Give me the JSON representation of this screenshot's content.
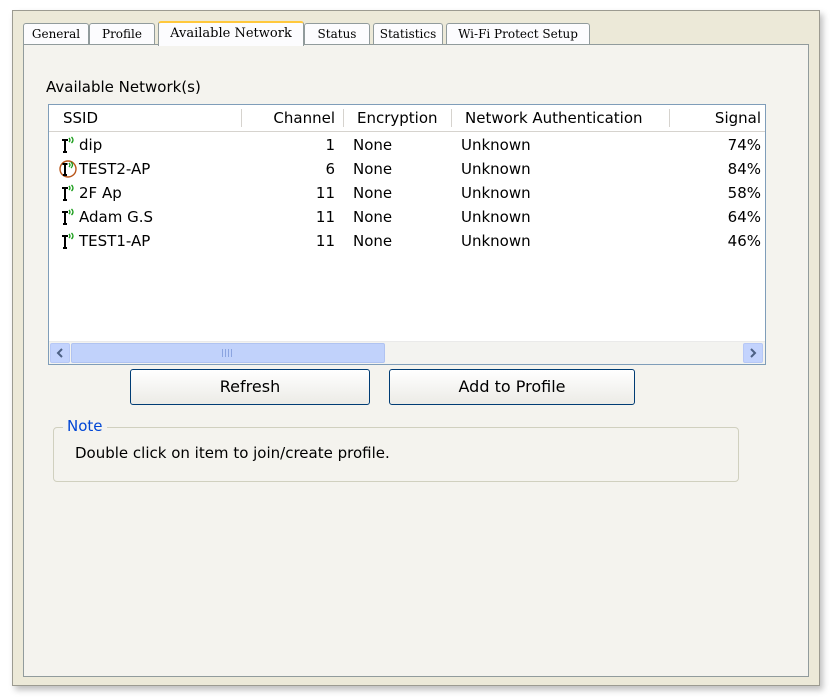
{
  "tabs": [
    {
      "label": "General"
    },
    {
      "label": "Profile"
    },
    {
      "label": "Available Network"
    },
    {
      "label": "Status"
    },
    {
      "label": "Statistics"
    },
    {
      "label": "Wi-Fi Protect Setup"
    }
  ],
  "active_tab": "Available Network",
  "section_label": "Available Network(s)",
  "columns": {
    "ssid": "SSID",
    "channel": "Channel",
    "encryption": "Encryption",
    "auth": "Network Authentication",
    "signal": "Signal"
  },
  "networks": [
    {
      "ssid": "dip",
      "channel": "1",
      "encryption": "None",
      "auth": "Unknown",
      "signal": "74%",
      "icon": "access-point-icon"
    },
    {
      "ssid": "TEST2-AP",
      "channel": "6",
      "encryption": "None",
      "auth": "Unknown",
      "signal": "84%",
      "icon": "connected-access-point-icon"
    },
    {
      "ssid": "2F Ap",
      "channel": "11",
      "encryption": "None",
      "auth": "Unknown",
      "signal": "58%",
      "icon": "access-point-icon"
    },
    {
      "ssid": "Adam G.S",
      "channel": "11",
      "encryption": "None",
      "auth": "Unknown",
      "signal": "64%",
      "icon": "access-point-icon"
    },
    {
      "ssid": "TEST1-AP",
      "channel": "11",
      "encryption": "None",
      "auth": "Unknown",
      "signal": "46%",
      "icon": "access-point-icon"
    }
  ],
  "buttons": {
    "refresh": "Refresh",
    "add_to_profile": "Add to Profile"
  },
  "note": {
    "title": "Note",
    "text": "Double click on item to join/create profile."
  },
  "colors": {
    "tab_highlight": "#ffc83c",
    "note_title": "#0046d5",
    "scroll_thumb": "#c1d2fb"
  }
}
